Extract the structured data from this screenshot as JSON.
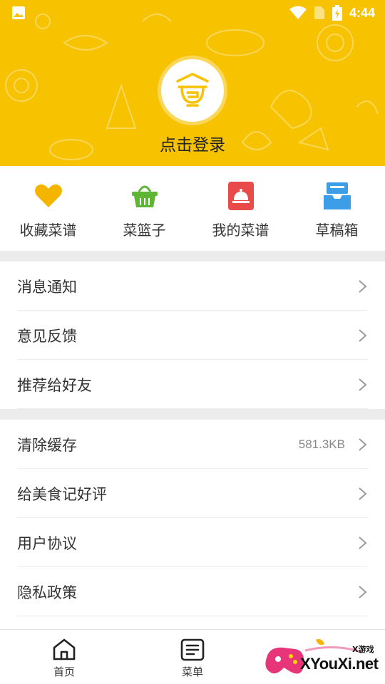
{
  "status_bar": {
    "time": "4:44"
  },
  "header": {
    "login_text": "点击登录"
  },
  "quick_actions": [
    {
      "label": "收藏菜谱",
      "icon": "heart-icon",
      "color": "#f5b400"
    },
    {
      "label": "菜篮子",
      "icon": "basket-icon",
      "color": "#5fb636"
    },
    {
      "label": "我的菜谱",
      "icon": "recipe-book-icon",
      "color": "#e94a4a"
    },
    {
      "label": "草稿箱",
      "icon": "draft-box-icon",
      "color": "#3b9ee6"
    }
  ],
  "menu_group_1": [
    {
      "label": "消息通知"
    },
    {
      "label": "意见反馈"
    },
    {
      "label": "推荐给好友"
    }
  ],
  "menu_group_2": [
    {
      "label": "清除缓存",
      "value": "581.3KB"
    },
    {
      "label": "给美食记好评"
    },
    {
      "label": "用户协议"
    },
    {
      "label": "隐私政策"
    }
  ],
  "bottom_nav": [
    {
      "label": "首页",
      "icon": "home-icon"
    },
    {
      "label": "菜单",
      "icon": "menu-list-icon"
    },
    {
      "label": "",
      "icon": "profile-icon"
    }
  ],
  "watermark": {
    "small": "X游戏",
    "big": "XYouXi.net"
  },
  "colors": {
    "header": "#f7c200",
    "chevron": "#9a9a9a",
    "separator": "#ececec"
  }
}
